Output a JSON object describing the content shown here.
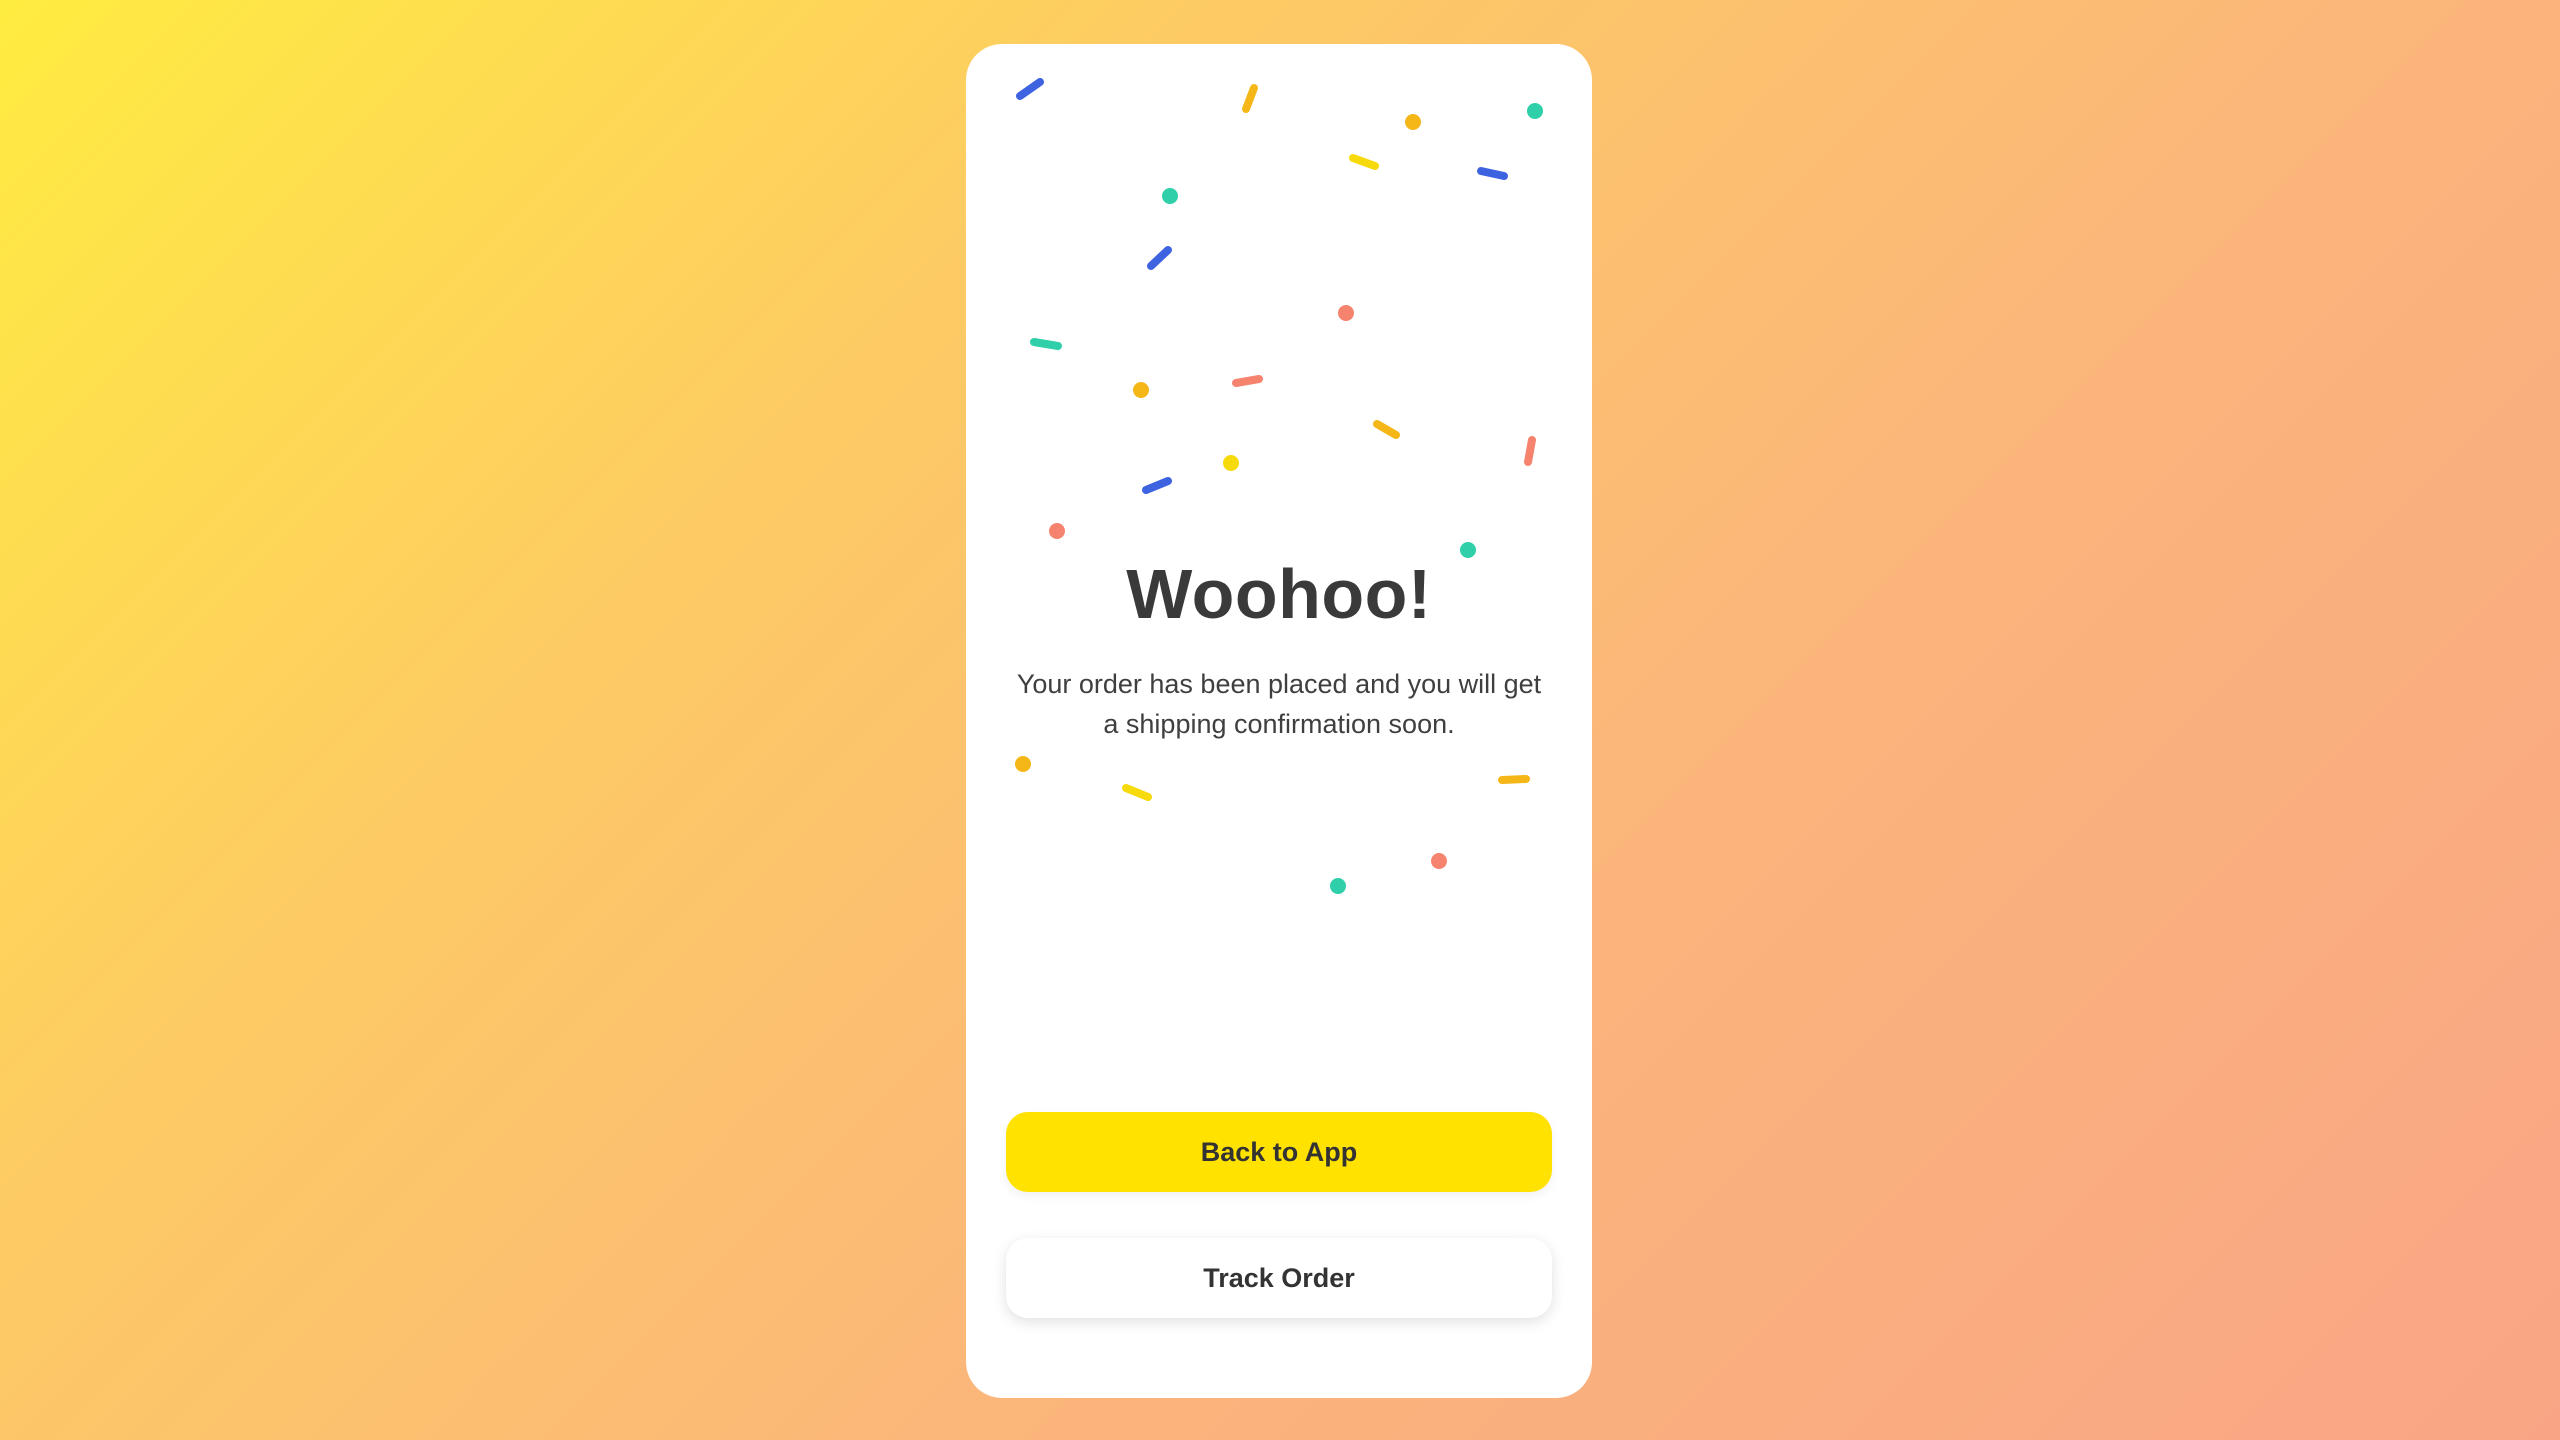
{
  "screen": {
    "title": "Woohoo!",
    "message": "Your order has been placed and you will get a shipping confirmation soon."
  },
  "actions": {
    "primary_label": "Back to App",
    "secondary_label": "Track Order"
  },
  "colors": {
    "primary_button": "#FFE200",
    "confetti": [
      "#3D63E0",
      "#F5B718",
      "#2ECFA9",
      "#F5836E",
      "#F7DA0C"
    ]
  }
}
